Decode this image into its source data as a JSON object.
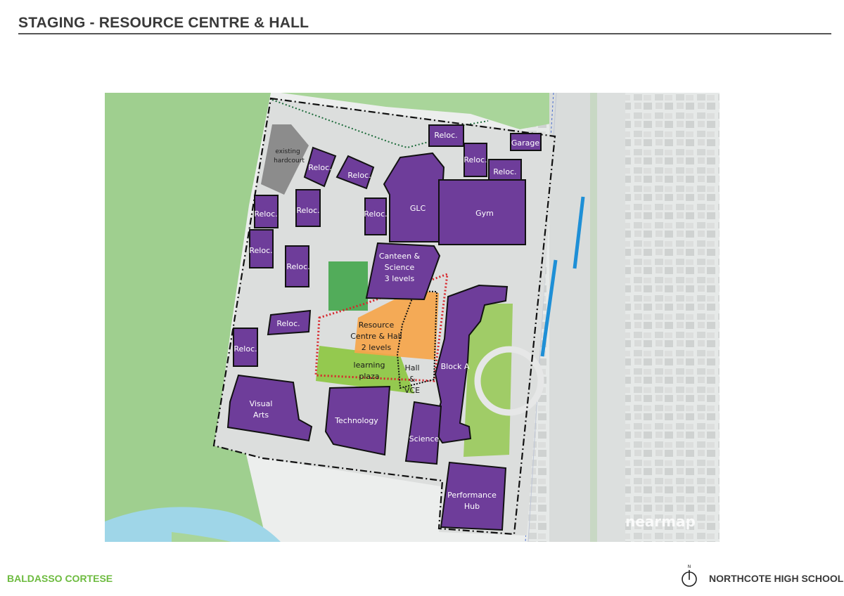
{
  "header": {
    "title": "STAGING - RESOURCE CENTRE & HALL"
  },
  "map": {
    "buildings": {
      "reloc_1": "Reloc.",
      "reloc_2": "Reloc.",
      "reloc_3": "Reloc.",
      "reloc_4": "Reloc.",
      "reloc_5": "Reloc.",
      "reloc_6": "Reloc.",
      "reloc_7": "Reloc.",
      "reloc_8": "Reloc.",
      "reloc_9": "Reloc.",
      "reloc_10": "Reloc.",
      "reloc_11": "Reloc.",
      "reloc_12": "Reloc.",
      "garage": "Garage",
      "glc": "GLC",
      "gym": "Gym",
      "canteen_l1": "Canteen &",
      "canteen_l2": "Science",
      "canteen_l3": "3 levels",
      "block_a": "Block A",
      "visual_arts_l1": "Visual",
      "visual_arts_l2": "Arts",
      "technology": "Technology",
      "science": "Science",
      "performance_l1": "Performance",
      "performance_l2": "Hub"
    },
    "areas": {
      "hardcourt_l1": "existing",
      "hardcourt_l2": "hardcourt",
      "resource_l1": "Resource",
      "resource_l2": "Centre & Hall",
      "resource_l3": "2 levels",
      "plaza_l1": "learning",
      "plaza_l2": "plaza",
      "hall_l1": "Hall",
      "hall_l2": "&",
      "hall_l3": "VCE"
    },
    "watermark": "nearmap",
    "colors": {
      "building": "#6e3d9a",
      "resource_area": "#f5a54a",
      "plaza": "#8cc63f",
      "boundary_red": "#d7262b",
      "park": "#a9d59a",
      "bike_lane": "#1e8fd6"
    }
  },
  "compass": {
    "label": "N"
  },
  "footer": {
    "left": "BALDASSO CORTESE",
    "right": "NORTHCOTE HIGH SCHOOL"
  }
}
